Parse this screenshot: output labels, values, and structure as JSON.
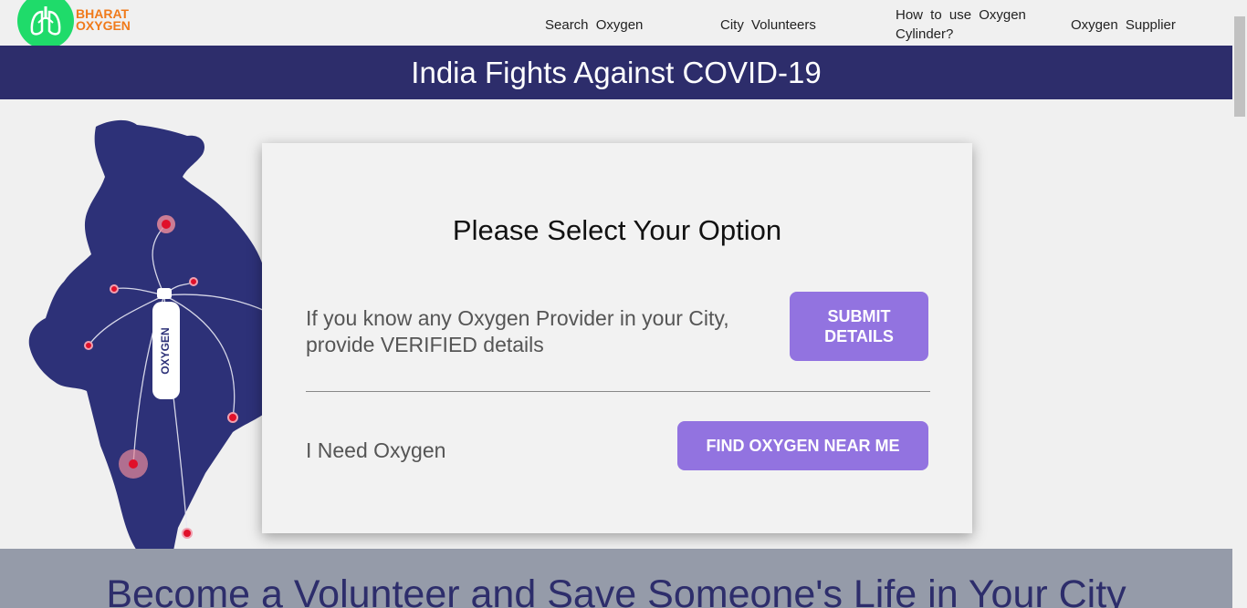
{
  "brand": {
    "line1": "BHARAT",
    "line2": "OXYGEN",
    "logo_icon": "lungs-icon"
  },
  "nav": [
    {
      "label": "Search  Oxygen"
    },
    {
      "label": "City  Volunteers"
    },
    {
      "label": "How  to  use  Oxygen Cylinder?"
    },
    {
      "label": "Oxygen  Supplier"
    }
  ],
  "banner": {
    "title": "India Fights Against COVID-19"
  },
  "map": {
    "cylinder_label": "OXYGEN"
  },
  "card": {
    "title": "Please Select Your Option",
    "option1_text": "If you know any Oxygen Provider in your City, provide VERIFIED details",
    "option1_button": "SUBMIT DETAILS",
    "option2_text": "I Need Oxygen",
    "option2_button": "FIND OXYGEN NEAR ME"
  },
  "footer": {
    "title": "Become a Volunteer and Save Someone's Life in Your City"
  },
  "colors": {
    "primary": "#2d2d6b",
    "button": "#9273e0",
    "logo_green": "#1fdb6a",
    "logo_orange": "#f07a1a"
  }
}
